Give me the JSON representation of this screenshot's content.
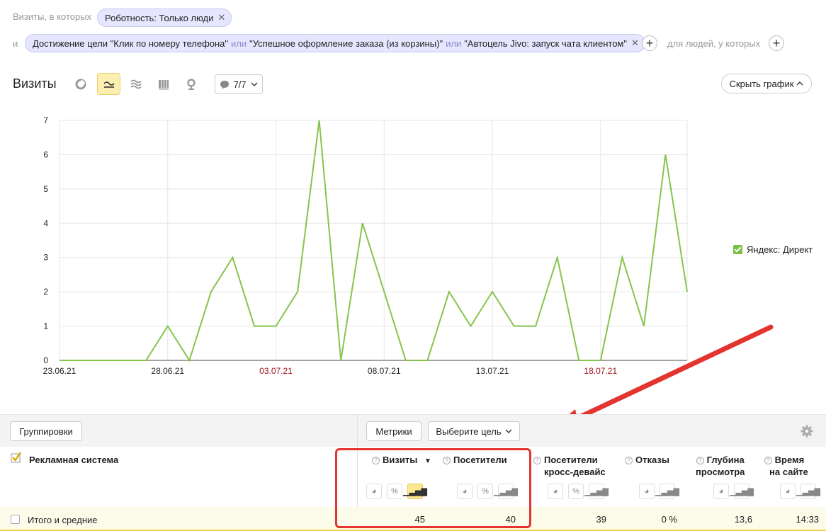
{
  "filters": {
    "prefix": "Визиты, в которых",
    "robot_chip": "Роботность: Только люди",
    "and_label": "и",
    "goal_chip": {
      "goal1": "Достижение цели \"Клик по номеру телефона\"",
      "or1": "или",
      "goal2": "\"Успешное оформление заказа (из корзины)\"",
      "or2": "или",
      "goal3": "\"Автоцель Jivo: запуск чата клиентом\""
    },
    "people_label": "для людей, у которых"
  },
  "toolbar": {
    "title": "Визиты",
    "series_counter": "7/7",
    "hide_chart": "Скрыть график"
  },
  "chart_data": {
    "type": "line",
    "x_labels": [
      "23.06.21",
      "28.06.21",
      "03.07.21",
      "08.07.21",
      "13.07.21",
      "18.07.21"
    ],
    "x_label_weekend": [
      false,
      false,
      true,
      false,
      false,
      true
    ],
    "x": [
      "23.06.21",
      "24.06.21",
      "25.06.21",
      "26.06.21",
      "27.06.21",
      "28.06.21",
      "29.06.21",
      "30.06.21",
      "01.07.21",
      "02.07.21",
      "03.07.21",
      "04.07.21",
      "05.07.21",
      "06.07.21",
      "07.07.21",
      "08.07.21",
      "09.07.21",
      "10.07.21",
      "11.07.21",
      "12.07.21",
      "13.07.21",
      "14.07.21",
      "15.07.21",
      "16.07.21",
      "17.07.21",
      "18.07.21",
      "19.07.21",
      "20.07.21",
      "21.07.21",
      "22.07.21"
    ],
    "series": [
      {
        "name": "Яндекс: Директ",
        "color": "#85c54b",
        "values": [
          0,
          0,
          0,
          0,
          0,
          1,
          0,
          2,
          3,
          1,
          1,
          2,
          7,
          0,
          4,
          2,
          0,
          0,
          2,
          1,
          2,
          1,
          1,
          3,
          0,
          0,
          3,
          1,
          6,
          2
        ]
      }
    ],
    "ylim": [
      0,
      7
    ],
    "yticks": [
      0,
      1,
      2,
      3,
      4,
      5,
      6,
      7
    ],
    "grid": true,
    "legend_position": "right"
  },
  "table": {
    "groupings_button": "Группировки",
    "metrics_button": "Метрики",
    "goal_select": "Выберите цель",
    "dimension_header": "Рекламная система",
    "columns": [
      {
        "label": "Визиты",
        "sorted": "▼"
      },
      {
        "label": "Посетители"
      },
      {
        "label1": "Посетители",
        "label2": "кросс-девайс"
      },
      {
        "label": "Отказы"
      },
      {
        "label1": "Глубина",
        "label2": "просмотра"
      },
      {
        "label1": "Время",
        "label2": "на сайте"
      }
    ],
    "totals_label": "Итого и средние",
    "totals": [
      "45",
      "40",
      "39",
      "0 %",
      "13,6",
      "14:33"
    ]
  },
  "colors": {
    "annotation": "#e3342f",
    "line": "#85c54b",
    "active": "#fdefb2"
  }
}
